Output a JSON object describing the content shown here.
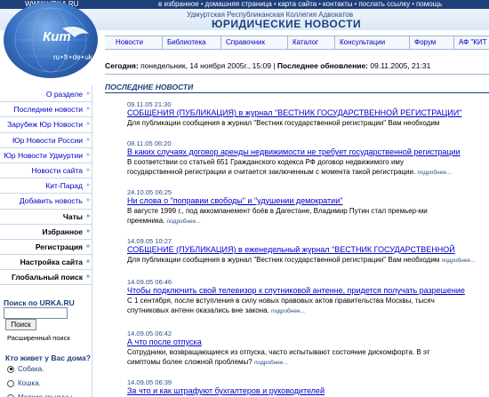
{
  "top": {
    "site_url": "WWW.URKA.RU",
    "links": [
      "в избранное",
      "домашняя страница",
      "карта сайта",
      "контакты",
      "послать ссылку",
      "помощь"
    ]
  },
  "header": {
    "org_name": "Удмуртская Республиканская Коллегия Адвокатов",
    "title": "ЮРИДИЧЕСКИЕ НОВОСТИ",
    "logo_text": "Кит",
    "languages": [
      "ru",
      "fr",
      "de",
      "uk"
    ]
  },
  "nav": {
    "tabs": [
      "Новости",
      "Библиотека",
      "Справочник",
      "Каталог",
      "Консультации",
      "Форум",
      "АФ \"КИТ"
    ]
  },
  "date_line": {
    "today_label": "Сегодня:",
    "today_value": "понедельник, 14 ноября 2005г., 15:09",
    "updated_label": "Последнее обновление:",
    "updated_value": "09.11.2005, 21:31"
  },
  "sidebar": {
    "items": [
      {
        "label": "О разделе",
        "bold": false
      },
      {
        "label": "Последние новости",
        "bold": false
      },
      {
        "label": "Зарубеж Юр Новости",
        "bold": false
      },
      {
        "label": "Юр Новости России",
        "bold": false
      },
      {
        "label": "Юр Новости Удмуртии",
        "bold": false
      },
      {
        "label": "Новости сайта",
        "bold": false
      },
      {
        "label": "Кит-Парад",
        "bold": false
      },
      {
        "label": "Добавить новость",
        "bold": false
      },
      {
        "label": "Чаты",
        "bold": true
      },
      {
        "label": "Избранное",
        "bold": true
      },
      {
        "label": "Регистрация",
        "bold": true
      },
      {
        "label": "Настройка сайта",
        "bold": true
      },
      {
        "label": "Глобальный поиск",
        "bold": true
      }
    ],
    "arrow": "»"
  },
  "search": {
    "title": "Поиск по URKA.RU",
    "input_value": "",
    "button": "Поиск",
    "advanced": "Расширенный поиск"
  },
  "poll": {
    "question": "Кто живет у Вас дома?",
    "options": [
      {
        "label": "Собака.",
        "selected": true
      },
      {
        "label": "Кошка.",
        "selected": false
      },
      {
        "label": "Мелкие грызуны.",
        "selected": false
      }
    ]
  },
  "news": {
    "section_title": "ПОСЛЕДНИЕ НОВОСТИ",
    "more_label": "подробнее...",
    "items": [
      {
        "date": "09.11.05 21:30",
        "title": "СОБЩЕНИЯ (ПУБЛИКАЦИЯ) в журнал \"ВЕСТНИК ГОСУДАРСТВЕННОЙ РЕГИСТРАЦИИ\"",
        "text": [
          "Для публикации сообщения в журнал \"Вестник государственной регистрации\" Вам необходим"
        ],
        "more": false
      },
      {
        "date": "08.11.05 06:20",
        "title": "В каких случаях договор аренды недвижимости не требует государственной регистрации",
        "text": [
          "В соответствии со статьей 651 Гражданского кодекса РФ договор недвижимого иму",
          "государственной регистрации и считается заключенным с момента такой регистрации."
        ],
        "more": true
      },
      {
        "date": "24.10.05 06:25",
        "title": "Ни слова о \"поправии свободы\" и \"удушении демократии\"",
        "text": [
          "В августе 1999 г., под аккомпанемент боёв в Дагестане, Владимир Путин стал премьер-ми",
          "преемника."
        ],
        "more": true
      },
      {
        "date": "14.09.05 10:27",
        "title": "СОБЩЕНИЕ (ПУБЛИКАЦИЯ) в еженедельный журнал \"ВЕСТНИК ГОСУДАРСТВЕННОЙ",
        "text": [
          "Для публикации сообщения в журнал \"Вестник государственной регистрации\" Вам необходим"
        ],
        "more": true
      },
      {
        "date": "14.09.05 06:46",
        "title": "Чтобы подключить свой телевизор к спутниковой антенне, придется получать разрешение",
        "text": [
          "С 1 сентября, после вступления в силу новых правовых актов правительства Москвы, тысяч",
          "спутниковых антенн оказались вне закона."
        ],
        "more": true
      },
      {
        "date": "14.09.05 06:42",
        "title": "А что после отпуска",
        "text": [
          "Сотрудники, возвращающиеся из отпуска, часто испытывают состояние дискомфорта. В эт",
          "симптомы более сложной проблемы?"
        ],
        "more": true
      },
      {
        "date": "14.09.05 06:39",
        "title": "За что и как штрафуют бухгалтеров и руководителей",
        "text": [],
        "more": false
      }
    ]
  }
}
